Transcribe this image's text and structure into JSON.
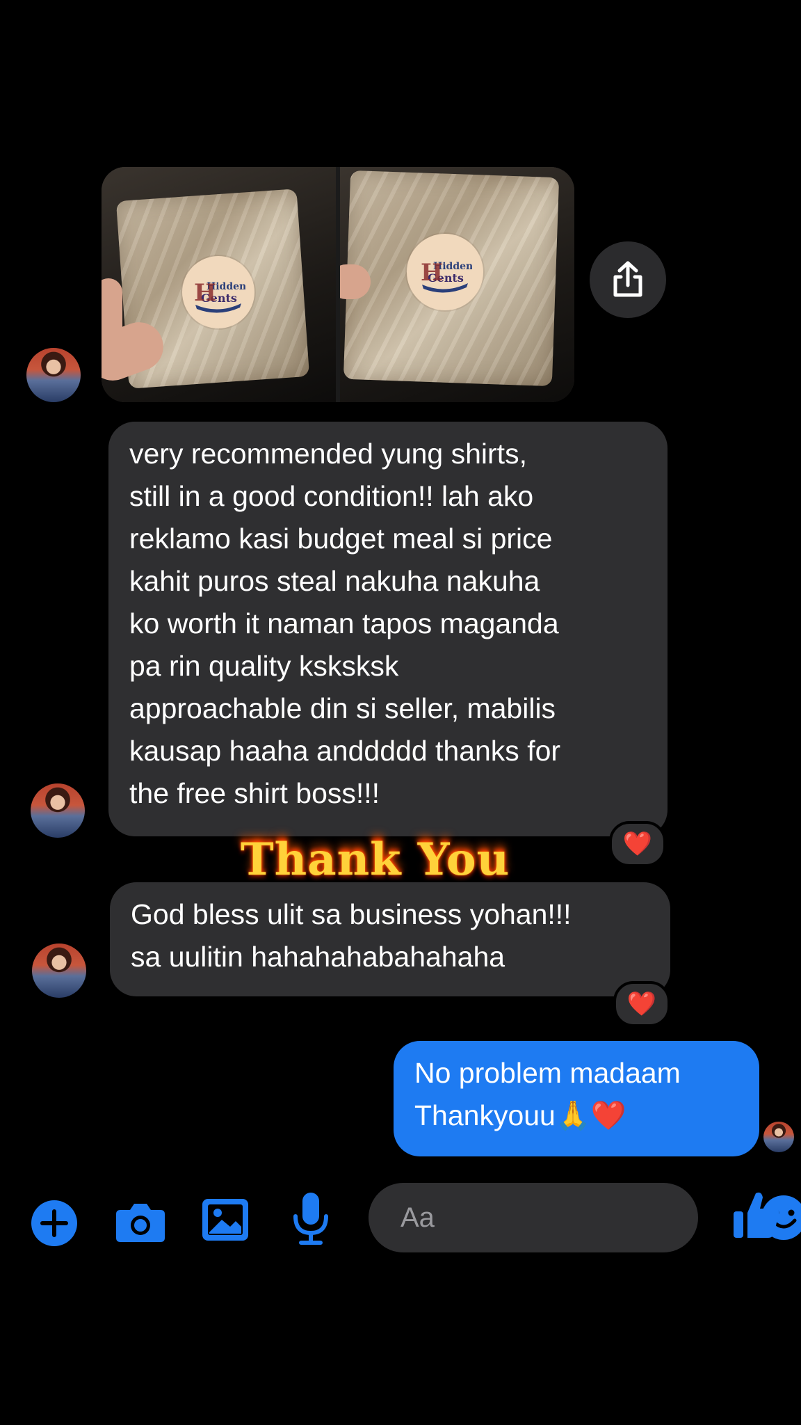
{
  "conversation": {
    "photos": [
      {
        "logo_text_top": "Hidden",
        "logo_text_bottom": "Gents"
      },
      {
        "logo_text_top": "Hidden",
        "logo_text_bottom": "Gents"
      }
    ],
    "messages": [
      {
        "direction": "incoming",
        "lines": [
          "very recommended yung shirts,",
          "still in a good condition!! lah ako",
          "reklamo kasi budget meal si price",
          "kahit puros steal nakuha nakuha",
          "ko worth it naman tapos maganda",
          "pa rin quality ksksksk",
          "approachable din si seller, mabilis",
          "kausap haaha anddddd thanks for",
          "the free shirt boss!!!"
        ],
        "reaction": "❤️"
      },
      {
        "direction": "incoming",
        "lines": [
          "God bless ulit sa business yohan!!!",
          "sa uulitin hahahahabahahaha"
        ],
        "reaction": "❤️"
      },
      {
        "direction": "outgoing",
        "lines": [
          "No problem madaam",
          "Thankyouu🙏❤️"
        ]
      }
    ],
    "overlay_text": "Thank You"
  },
  "composer": {
    "placeholder": "Aa"
  },
  "colors": {
    "background": "#000000",
    "incoming_bubble": "#2f2f31",
    "outgoing_bubble": "#1e7bf2",
    "accent": "#1e7bf2"
  },
  "icons": [
    "share-icon",
    "plus-icon",
    "camera-icon",
    "gallery-icon",
    "microphone-icon",
    "emoji-icon",
    "thumbs-up-icon",
    "heart-icon"
  ]
}
